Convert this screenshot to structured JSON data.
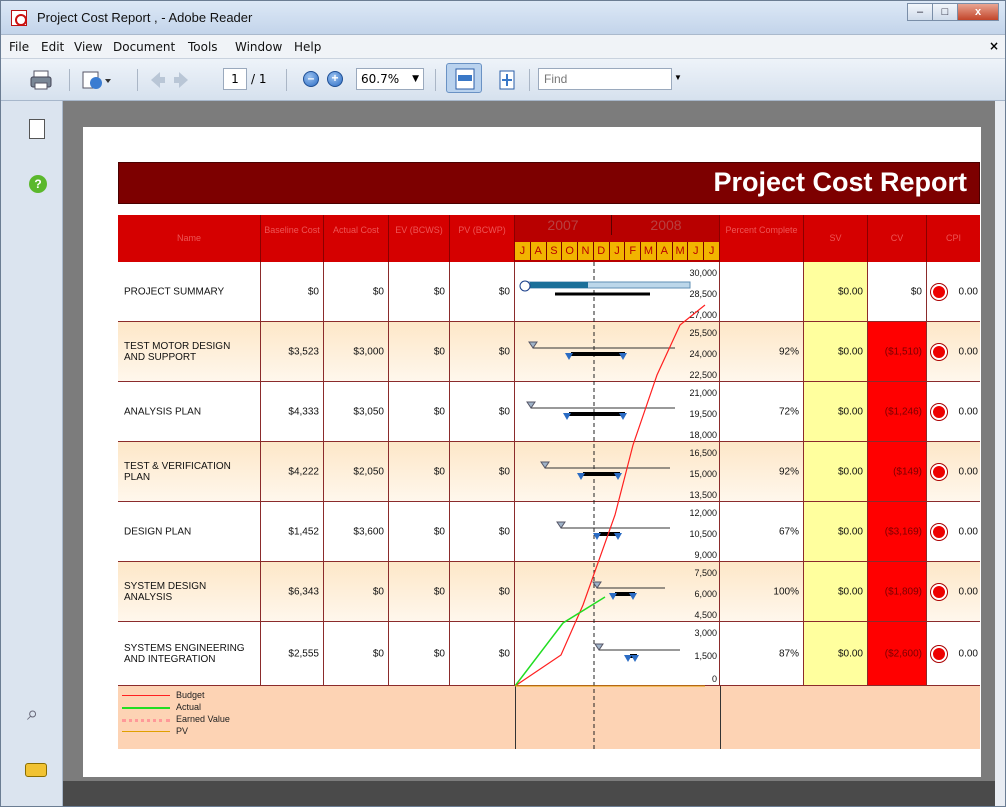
{
  "window": {
    "title": "Project Cost Report ,  - Adobe Reader"
  },
  "menu": [
    "File",
    "Edit",
    "View",
    "Document",
    "Tools",
    "Window",
    "Help"
  ],
  "toolbar": {
    "page_current": "1",
    "page_total": "/ 1",
    "zoom": "60.7%",
    "find_placeholder": "Find"
  },
  "report": {
    "title": "Project Cost Report",
    "headers": {
      "name": "Name",
      "baseline": "Baseline Cost",
      "actual": "Actual Cost",
      "ev": "EV (BCWS)",
      "pv": "PV (BCWP)",
      "year1": "2007",
      "year2": "2008",
      "months": [
        "J",
        "A",
        "S",
        "O",
        "N",
        "D",
        "J",
        "F",
        "M",
        "A",
        "M",
        "J",
        "J"
      ],
      "percent": "Percent Complete",
      "sv": "SV",
      "cv": "CV",
      "cpi": "CPI"
    },
    "rows": [
      {
        "name": "PROJECT SUMMARY",
        "baseline": "$0",
        "actual": "$0",
        "ev": "$0",
        "pv": "$0",
        "percent": "",
        "sv": "$0.00",
        "cv": "$0",
        "cpi": "0.00",
        "axis": [
          "30,000",
          "28,500",
          "27,000"
        ]
      },
      {
        "name": "TEST MOTOR DESIGN AND SUPPORT",
        "baseline": "$3,523",
        "actual": "$3,000",
        "ev": "$0",
        "pv": "$0",
        "percent": "92%",
        "sv": "$0.00",
        "cv": "($1,510)",
        "cpi": "0.00",
        "axis": [
          "25,500",
          "24,000",
          "22,500"
        ]
      },
      {
        "name": "ANALYSIS PLAN",
        "baseline": "$4,333",
        "actual": "$3,050",
        "ev": "$0",
        "pv": "$0",
        "percent": "72%",
        "sv": "$0.00",
        "cv": "($1,246)",
        "cpi": "0.00",
        "axis": [
          "21,000",
          "19,500",
          "18,000"
        ]
      },
      {
        "name": "TEST & VERIFICATION PLAN",
        "baseline": "$4,222",
        "actual": "$2,050",
        "ev": "$0",
        "pv": "$0",
        "percent": "92%",
        "sv": "$0.00",
        "cv": "($149)",
        "cpi": "0.00",
        "axis": [
          "16,500",
          "15,000",
          "13,500"
        ]
      },
      {
        "name": "DESIGN PLAN",
        "baseline": "$1,452",
        "actual": "$3,600",
        "ev": "$0",
        "pv": "$0",
        "percent": "67%",
        "sv": "$0.00",
        "cv": "($3,169)",
        "cpi": "0.00",
        "axis": [
          "12,000",
          "10,500",
          "9,000"
        ]
      },
      {
        "name": "SYSTEM DESIGN ANALYSIS",
        "baseline": "$6,343",
        "actual": "$0",
        "ev": "$0",
        "pv": "$0",
        "percent": "100%",
        "sv": "$0.00",
        "cv": "($1,809)",
        "cpi": "0.00",
        "axis": [
          "7,500",
          "6,000",
          "4,500"
        ]
      },
      {
        "name": "SYSTEMS ENGINEERING AND INTEGRATION",
        "baseline": "$2,555",
        "actual": "$0",
        "ev": "$0",
        "pv": "$0",
        "percent": "87%",
        "sv": "$0.00",
        "cv": "($2,600)",
        "cpi": "0.00",
        "axis": [
          "3,000",
          "1,500",
          "0"
        ]
      }
    ],
    "legend": [
      "Budget",
      "Actual",
      "Earned Value",
      "PV"
    ]
  },
  "colors": {
    "banner": "#7d0000",
    "header": "#d50000",
    "sv": "#ffff9e",
    "cv_negative": "#ff0000",
    "budget": "#ff2020",
    "actual": "#22dd22",
    "earned": "#ff9999",
    "pv": "#e0a000"
  }
}
